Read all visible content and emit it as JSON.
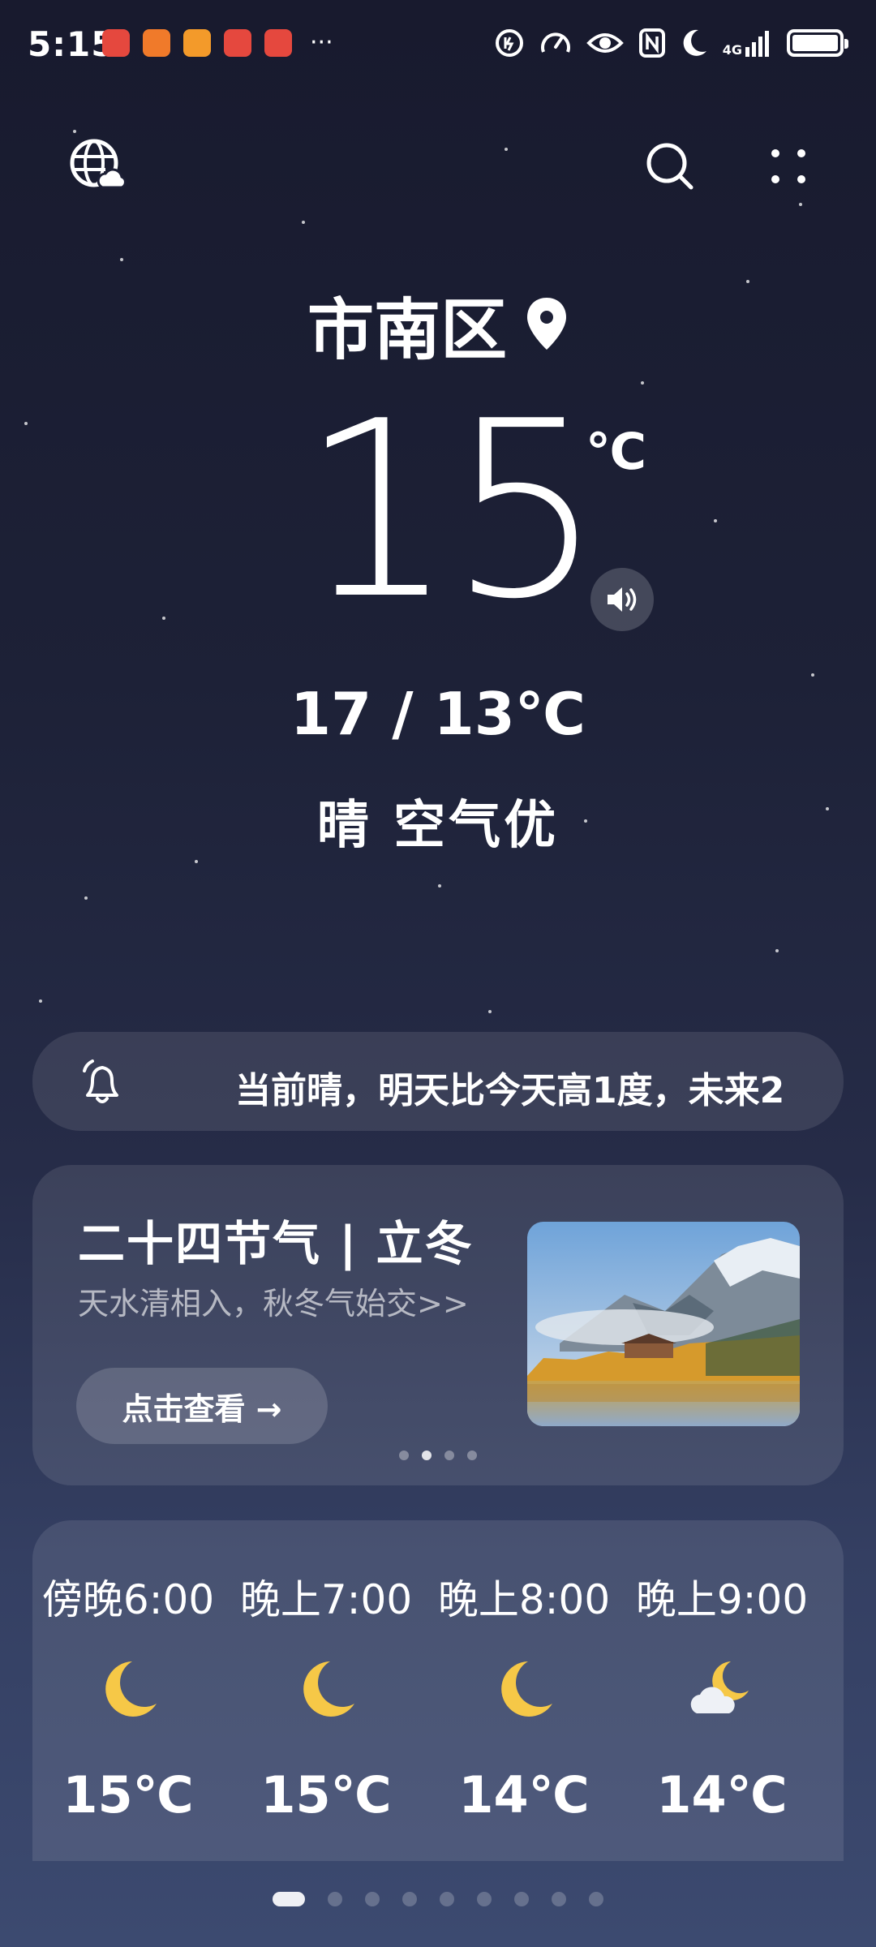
{
  "status_bar": {
    "time": "5:15",
    "network": "4G",
    "app_icons": [
      "app-icon-a",
      "app-icon-b",
      "app-icon-c",
      "app-icon-d",
      "app-icon-e"
    ],
    "more": "···"
  },
  "location": {
    "city": "市南区"
  },
  "current": {
    "temperature": "15",
    "unit": "℃",
    "range": "17 / 13℃",
    "condition": "晴 空气优"
  },
  "ticker": {
    "text": "当前晴，明天比今天高1度，未来2"
  },
  "solar_term_card": {
    "title": "二十四节气 | 立冬",
    "subtitle": "天水清相入，秋冬气始交>>",
    "button_label": "点击查看 →",
    "pager_count": 4,
    "pager_active": 1
  },
  "hourly": [
    {
      "label": "傍晚6:00",
      "icon": "moon-icon",
      "temp": "15℃"
    },
    {
      "label": "晚上7:00",
      "icon": "moon-icon",
      "temp": "15℃"
    },
    {
      "label": "晚上8:00",
      "icon": "moon-icon",
      "temp": "14℃"
    },
    {
      "label": "晚上9:00",
      "icon": "moon-cloud-icon",
      "temp": "14℃"
    }
  ],
  "page_indicator": {
    "count": 9,
    "active": 0
  },
  "colors": {
    "moon": "#f6c847",
    "background_top": "#181a2e",
    "background_bottom": "#3c4a70"
  }
}
